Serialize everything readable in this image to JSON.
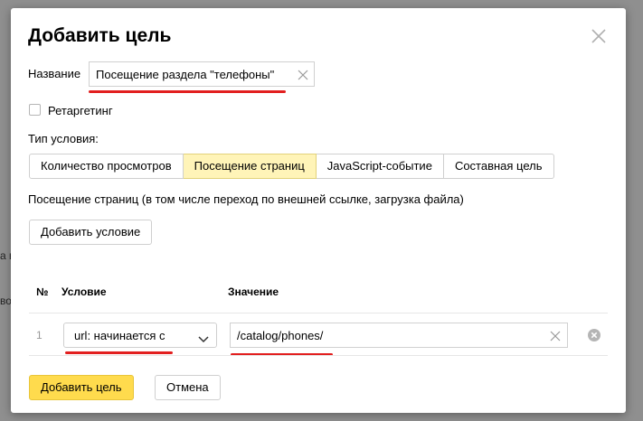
{
  "background": {
    "fragments": [
      "",
      "а в",
      "во",
      "во"
    ]
  },
  "dialog": {
    "title": "Добавить цель",
    "name_label": "Название",
    "name_value": "Посещение раздела \"телефоны\"",
    "retargeting_label": "Ретаргетинг",
    "condition_type_label": "Тип условия:",
    "condition_types": [
      {
        "label": "Количество просмотров",
        "active": false
      },
      {
        "label": "Посещение страниц",
        "active": true
      },
      {
        "label": "JavaScript-событие",
        "active": false
      },
      {
        "label": "Составная цель",
        "active": false
      }
    ],
    "description": "Посещение страниц (в том числе переход по внешней ссылке, загрузка файла)",
    "add_condition_label": "Добавить условие",
    "table": {
      "headers": {
        "number": "№",
        "condition": "Условие",
        "value": "Значение"
      },
      "rows": [
        {
          "number": "1",
          "condition": "url: начинается с",
          "value": "/catalog/phones/"
        }
      ]
    },
    "submit_label": "Добавить цель",
    "cancel_label": "Отмена"
  },
  "colors": {
    "accent_button": "#ffdb4d",
    "active_tab": "#fff4b8",
    "annotation_underline": "#e21f1f"
  },
  "icons": {
    "close": "close-icon",
    "clear": "clear-icon",
    "chevron": "chevron-down-icon",
    "remove": "remove-circle-icon"
  }
}
